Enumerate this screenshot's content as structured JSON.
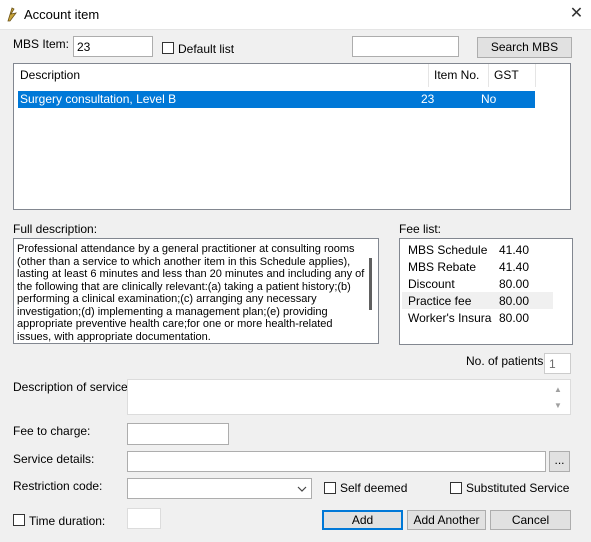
{
  "window": {
    "title": "Account item"
  },
  "mbs": {
    "label": "MBS Item:",
    "value": "23",
    "default_list_label": "Default list",
    "search_value": "",
    "search_button": "Search MBS"
  },
  "items_table": {
    "headers": {
      "description": "Description",
      "item_no": "Item No.",
      "gst": "GST"
    },
    "rows": [
      {
        "description": "Surgery consultation, Level B",
        "item_no": "23",
        "gst": "No"
      }
    ]
  },
  "full_description": {
    "label": "Full description:",
    "text": "Professional attendance by a general practitioner at consulting rooms (other than a service to which another item in this Schedule applies), lasting at least 6 minutes and less than 20 minutes and including any of the following that are clinically relevant:(a) taking a patient history;(b) performing a clinical examination;(c) arranging any necessary investigation;(d) implementing a management plan;(e) providing appropriate preventive health care;for one or more health-related issues, with appropriate documentation."
  },
  "fee_list": {
    "label": "Fee list:",
    "items": [
      {
        "name": "MBS Schedule",
        "value": "41.40"
      },
      {
        "name": "MBS Rebate",
        "value": "41.40"
      },
      {
        "name": "Discount",
        "value": "80.00"
      },
      {
        "name": "Practice fee",
        "value": "80.00"
      },
      {
        "name": "Worker's Insurance",
        "value": "80.00"
      }
    ]
  },
  "patients": {
    "label": "No. of patients:",
    "value": "1"
  },
  "service_description": {
    "label": "Description of service:",
    "value": ""
  },
  "fee_to_charge": {
    "label": "Fee to charge:",
    "value": ""
  },
  "service_details": {
    "label": "Service details:",
    "value": "",
    "browse_label": "..."
  },
  "restriction": {
    "label": "Restriction code:",
    "value": "",
    "self_deemed_label": "Self deemed",
    "substituted_label": "Substituted Service"
  },
  "time_duration": {
    "label": "Time duration:",
    "value": ""
  },
  "buttons": {
    "add": "Add",
    "add_another": "Add Another",
    "cancel": "Cancel"
  },
  "colors": {
    "selection": "#0078d7",
    "accent_border": "#0078d7"
  }
}
